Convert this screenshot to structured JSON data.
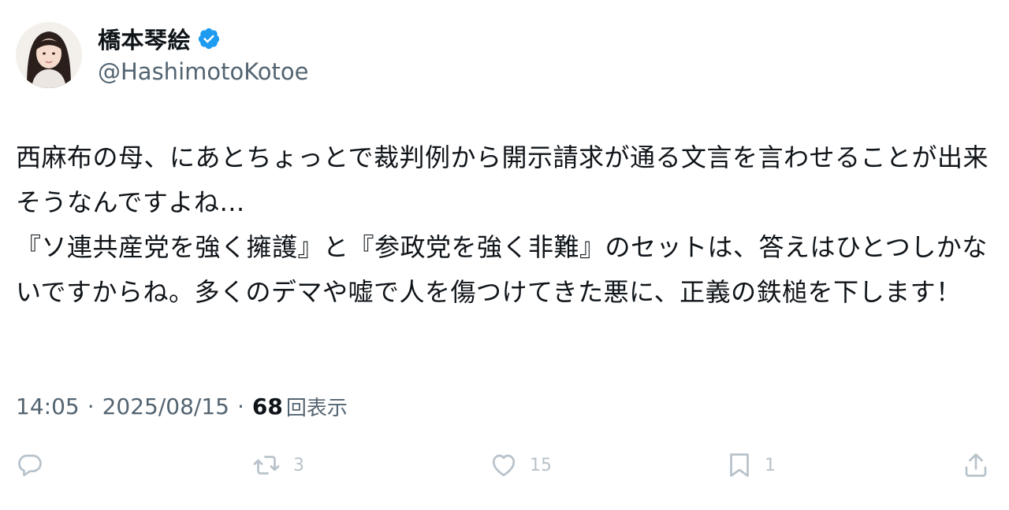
{
  "author": {
    "display_name": "橋本琴絵",
    "handle": "@HashimotoKotoe",
    "verified": true,
    "avatar": "profile-photo"
  },
  "tweet": {
    "paragraphs": [
      "西麻布の母、にあとちょっとで裁判例から開示請求が通る文言を言わせることが出来そうなんですよね…",
      "『ソ連共産党を強く擁護』と『参政党を強く非難』のセットは、答えはひとつしかないですからね。多くのデマや嘘で人を傷つけてきた悪に、正義の鉄槌を下します！"
    ],
    "time": "14:05",
    "date": "2025/08/15",
    "views_count": "68",
    "views_label": "回表示"
  },
  "actions": {
    "reply": {
      "icon": "reply-icon",
      "count": ""
    },
    "retweet": {
      "icon": "retweet-icon",
      "count": "3"
    },
    "like": {
      "icon": "heart-icon",
      "count": "15"
    },
    "bookmark": {
      "icon": "bookmark-icon",
      "count": "1"
    },
    "share": {
      "icon": "share-icon"
    }
  },
  "colors": {
    "verified_badge": "#1d9bf0",
    "secondary_text": "#536471",
    "faded_action": "#b8c2ca"
  }
}
